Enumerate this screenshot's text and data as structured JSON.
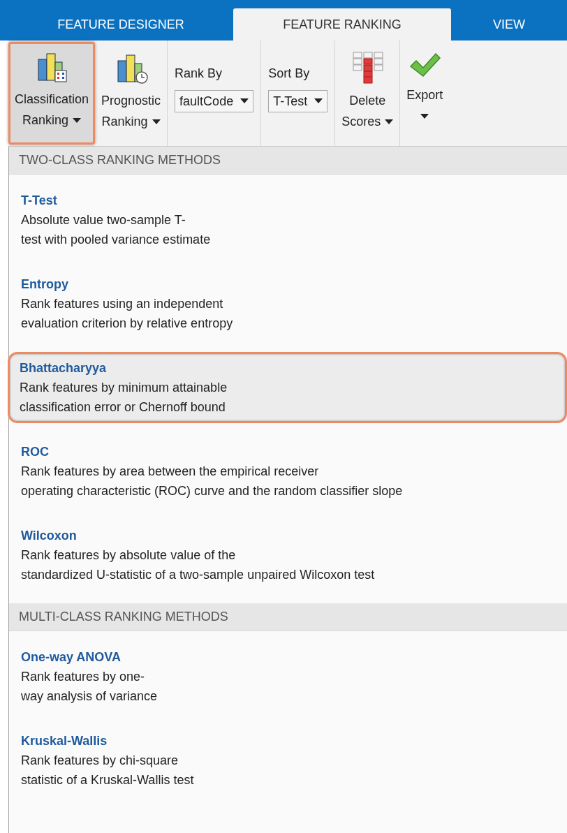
{
  "tabs": [
    {
      "label": "FEATURE DESIGNER",
      "selected": false
    },
    {
      "label": "FEATURE RANKING",
      "selected": true
    },
    {
      "label": "VIEW",
      "selected": false
    }
  ],
  "toolbar": [
    {
      "kind": "bigbutton",
      "label": "Classification\nRanking",
      "highlighted": true
    },
    {
      "kind": "bigbutton",
      "label": "Prognostic\nRanking",
      "highlighted": false
    },
    {
      "kind": "select",
      "label": "Rank By",
      "value": "faultCode"
    },
    {
      "kind": "select",
      "label": "Sort By",
      "value": "T-Test"
    },
    {
      "kind": "bigbutton",
      "label": "Delete\nScores",
      "highlighted": false
    },
    {
      "kind": "bigbutton",
      "label": "Export",
      "highlighted": false
    }
  ],
  "menu": [
    {
      "header": "TWO-CLASS RANKING METHODS",
      "items": [
        {
          "title": "T-Test",
          "description": "Absolute value two-sample T-\ntest with pooled variance estimate",
          "highlighted": false
        },
        {
          "title": "Entropy",
          "description": "Rank features using an independent\nevaluation criterion by relative entropy",
          "highlighted": false
        },
        {
          "title": "Bhattacharyya",
          "description": "Rank features by minimum attainable\nclassification error or Chernoff bound",
          "highlighted": true
        },
        {
          "title": "ROC",
          "description": "Rank features by area between the empirical receiver\noperating characteristic (ROC) curve and the random classifier slope",
          "highlighted": false
        },
        {
          "title": "Wilcoxon",
          "description": "Rank features by absolute value of the\nstandardized U-statistic of a two-sample unpaired Wilcoxon test",
          "highlighted": false
        }
      ]
    },
    {
      "header": "MULTI-CLASS RANKING METHODS",
      "items": [
        {
          "title": "One-way ANOVA",
          "description": "Rank features by one-\nway analysis of variance",
          "highlighted": false
        },
        {
          "title": "Kruskal-Wallis",
          "description": "Rank features by chi-square\nstatistic of a Kruskal-Wallis test",
          "highlighted": false
        }
      ]
    }
  ]
}
